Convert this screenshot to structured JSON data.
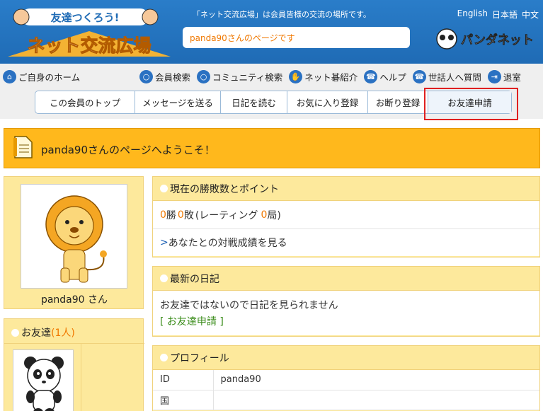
{
  "header": {
    "logo_text": "友達つくろう! ネット交流広場",
    "tagline": "「ネット交流広場」は会員皆様の交流の場所です。",
    "languages": [
      "English",
      "日本語",
      "中文"
    ],
    "page_url_text": "panda90さんのページです",
    "brand": "パンダネット"
  },
  "nav": {
    "home": "ご自身のホーム",
    "links": [
      "会員検索",
      "コミュニティ検索",
      "ネット碁紹介",
      "ヘルプ",
      "世話人へ質問",
      "退室"
    ]
  },
  "tabs": [
    {
      "label": "この会員のトップ",
      "active": false
    },
    {
      "label": "メッセージを送る",
      "active": false
    },
    {
      "label": "日記を読む",
      "active": false
    },
    {
      "label": "お気に入り登録",
      "active": false
    },
    {
      "label": "お断り登録",
      "active": false
    },
    {
      "label": "お友達申請",
      "active": true
    }
  ],
  "welcome": {
    "message": "panda90さんのページへようこそ！"
  },
  "profile": {
    "name": "panda90 さん"
  },
  "friends": {
    "title": "お友達",
    "count_text": "(1人)"
  },
  "record": {
    "title": "現在の勝敗数とポイント",
    "wins": "0",
    "win_label": "勝",
    "losses": "0",
    "loss_label": "敗",
    "rating_prefix": "(レーティング",
    "rating_games": "0",
    "rating_suffix": "局)",
    "link_arrow": ">",
    "link": "あなたとの対戦成績を見る"
  },
  "diary": {
    "title": "最新の日記",
    "notice": "お友達ではないので日記を見られません",
    "action": "[ お友達申請 ]"
  },
  "profile_info": {
    "title": "プロフィール",
    "rows": [
      {
        "key": "ID",
        "value": "panda90"
      },
      {
        "key": "国",
        "value": ""
      }
    ]
  },
  "colors": {
    "header_blue": "#2a7dc9",
    "accent_orange": "#f07800",
    "panel_yellow": "#fde99c",
    "welcome_orange": "#ffb81c",
    "highlight_red": "#e02020"
  }
}
